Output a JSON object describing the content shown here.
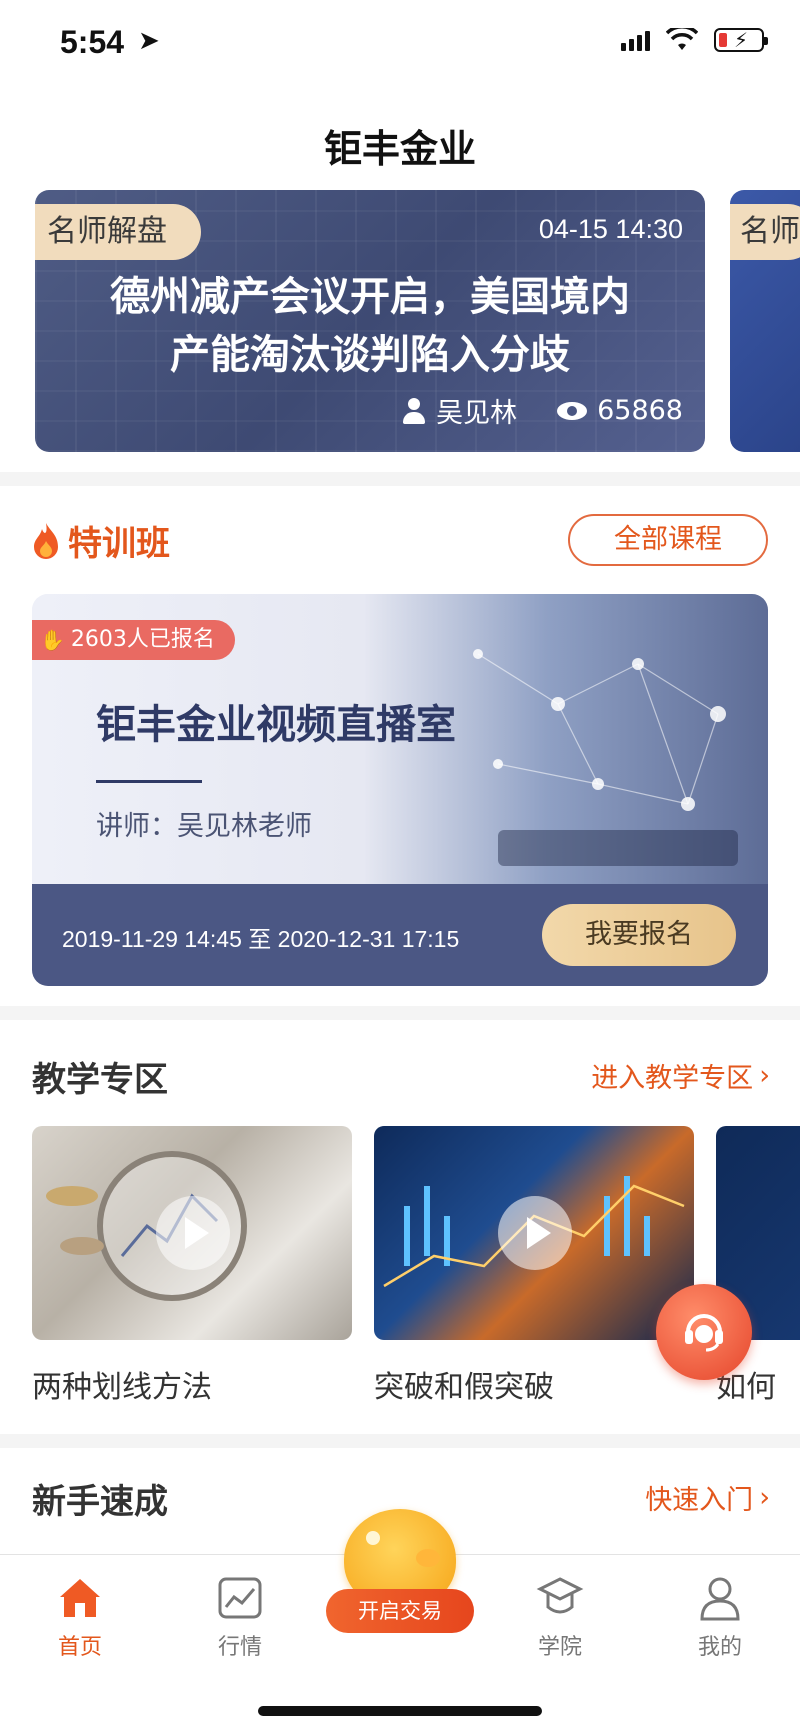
{
  "status_bar": {
    "time": "5:54"
  },
  "header": {
    "title": "钜丰金业"
  },
  "banner": {
    "tag": "名师解盘",
    "time": "04-15 14:30",
    "headline_line1": "德州减产会议开启，美国境内",
    "headline_line2": "产能淘汰谈判陷入分歧",
    "author": "吴见林",
    "views": "65868",
    "peek_tag": "名师"
  },
  "training": {
    "title": "特训班",
    "all_courses_label": "全部课程",
    "course": {
      "enrolled": "2603人已报名",
      "name": "钜丰金业视频直播室",
      "teacher": "讲师：吴见林老师",
      "dates": "2019-11-29 14:45 至 2020-12-31 17:15",
      "signup_label": "我要报名"
    }
  },
  "teaching": {
    "title": "教学专区",
    "link_label": "进入教学专区",
    "videos": [
      {
        "title": "两种划线方法"
      },
      {
        "title": "突破和假突破"
      },
      {
        "title": "如何"
      }
    ]
  },
  "beginner": {
    "title": "新手速成",
    "link_label": "快速入门"
  },
  "tab_bar": {
    "tabs": [
      {
        "label": "首页",
        "icon": "home-icon",
        "active": true
      },
      {
        "label": "行情",
        "icon": "chart-icon",
        "active": false
      },
      {
        "label": "开启交易",
        "icon": "piggy-bank-icon",
        "active": false
      },
      {
        "label": "学院",
        "icon": "graduation-cap-icon",
        "active": false
      },
      {
        "label": "我的",
        "icon": "user-icon",
        "active": false
      }
    ]
  },
  "colors": {
    "accent": "#e3571c",
    "banner_bg": "#4f5c85",
    "gold": "#f1dcbd"
  }
}
